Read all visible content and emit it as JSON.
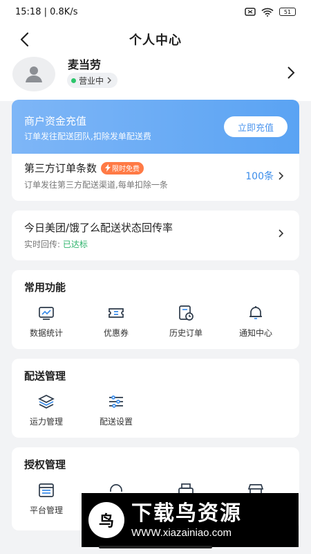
{
  "status_bar": {
    "time": "15:18",
    "speed": "0.8K/s",
    "battery": "51"
  },
  "nav": {
    "title": "个人中心"
  },
  "profile": {
    "name": "麦当劳",
    "status": "营业中"
  },
  "recharge": {
    "title": "商户资金充值",
    "desc": "订单发往配送团队,扣除发单配送费",
    "button": "立即充值"
  },
  "third_party": {
    "title": "第三方订单条数",
    "badge": "限时免费",
    "desc": "订单发往第三方配送渠道,每单扣除一条",
    "count": "100条"
  },
  "rate": {
    "title": "今日美团/饿了么配送状态回传率",
    "label": "实时回传:",
    "status": "已达标"
  },
  "common": {
    "title": "常用功能",
    "items": [
      {
        "label": "数据统计",
        "icon": "chart-icon"
      },
      {
        "label": "优惠券",
        "icon": "coupon-icon"
      },
      {
        "label": "历史订单",
        "icon": "history-order-icon"
      },
      {
        "label": "通知中心",
        "icon": "bell-icon"
      }
    ]
  },
  "delivery": {
    "title": "配送管理",
    "items": [
      {
        "label": "运力管理",
        "icon": "layers-icon"
      },
      {
        "label": "配送设置",
        "icon": "sliders-icon"
      }
    ]
  },
  "auth": {
    "title": "授权管理",
    "items": [
      {
        "label": "平台管理",
        "icon": "platform-icon"
      },
      {
        "label": "",
        "icon": "headset-icon"
      },
      {
        "label": "",
        "icon": "printer-icon"
      },
      {
        "label": "",
        "icon": "store-icon"
      }
    ]
  },
  "watermark": {
    "text": "下载鸟资源",
    "url": "WWW.xiazainiao.com"
  },
  "colors": {
    "accent": "#3c8dea",
    "recharge_start": "#7eb6f7",
    "recharge_end": "#5aa3f3",
    "success": "#2cb36b",
    "badge": "#ff7a45"
  }
}
